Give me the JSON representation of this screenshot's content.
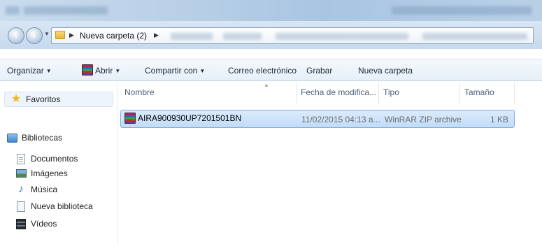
{
  "address_bar": {
    "folder_icon": "folder-icon",
    "path": [
      "Nueva carpeta (2)"
    ]
  },
  "toolbar": {
    "organize_label": "Organizar",
    "open_label": "Abrir",
    "share_label": "Compartir con",
    "email_label": "Correo electrónico",
    "burn_label": "Grabar",
    "new_folder_label": "Nueva carpeta"
  },
  "sidebar": {
    "favorites_label": "Favoritos",
    "libraries_label": "Bibliotecas",
    "items": [
      {
        "label": "Documentos",
        "icon": "document-icon"
      },
      {
        "label": "Imágenes",
        "icon": "image-icon"
      },
      {
        "label": "Música",
        "icon": "music-icon"
      },
      {
        "label": "Nueva biblioteca",
        "icon": "library-icon"
      },
      {
        "label": "Vídeos",
        "icon": "video-icon"
      }
    ]
  },
  "file_list": {
    "columns": {
      "name": "Nombre",
      "date": "Fecha de modifica...",
      "type": "Tipo",
      "size": "Tamaño"
    },
    "files": [
      {
        "name": "AIRA900930UP7201501BN",
        "date": "11/02/2015 04:13 a...",
        "type": "WinRAR ZIP archive",
        "size": "1 KB",
        "selected": true,
        "icon": "winrar-icon"
      }
    ]
  },
  "colors": {
    "selection": "#cde3fa",
    "toolbar": "#eef3fa",
    "accent": "#3f86c9"
  }
}
